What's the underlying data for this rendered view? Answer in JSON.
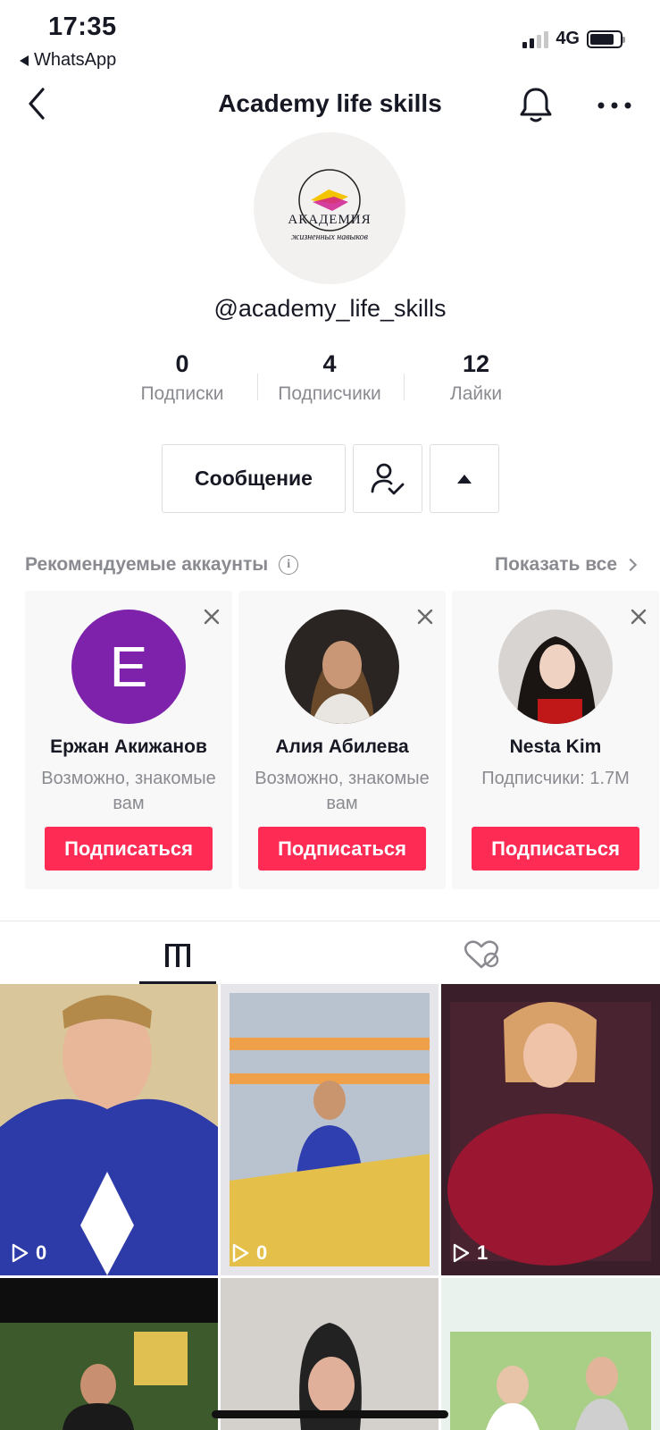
{
  "status_bar": {
    "time": "17:35",
    "back_app": "WhatsApp",
    "network": "4G"
  },
  "header": {
    "title": "Academy life skills"
  },
  "profile": {
    "logo_text": "АКАДЕМИЯ",
    "logo_subtext": "жизненных навыков",
    "username": "@academy_life_skills",
    "stats": [
      {
        "value": "0",
        "label": "Подписки"
      },
      {
        "value": "4",
        "label": "Подписчики"
      },
      {
        "value": "12",
        "label": "Лайки"
      }
    ]
  },
  "actions": {
    "message_label": "Сообщение"
  },
  "recommended": {
    "title": "Рекомендуемые аккаунты",
    "show_all": "Показать все",
    "cards": [
      {
        "name": "Ержан Акижанов",
        "subtitle": "Возможно, знакомые вам",
        "initial": "Е",
        "button": "Подписаться"
      },
      {
        "name": "Алия Абилева",
        "subtitle": "Возможно, знакомые вам",
        "button": "Подписаться"
      },
      {
        "name": "Nesta Kim",
        "subtitle": "Подписчики: 1.7M",
        "button": "Подписаться"
      }
    ]
  },
  "videos": [
    {
      "views": "0",
      "color": "#2d3ba8"
    },
    {
      "views": "0",
      "color": "#d9b24a"
    },
    {
      "views": "1",
      "color": "#8a1530"
    },
    {
      "views": "",
      "color": "#3a5a2a"
    },
    {
      "views": "",
      "color": "#c9c2bf"
    },
    {
      "views": "",
      "color": "#9ec47a"
    }
  ],
  "colors": {
    "accent": "#fe2c55",
    "initial_avatar": "#7e22ac"
  }
}
